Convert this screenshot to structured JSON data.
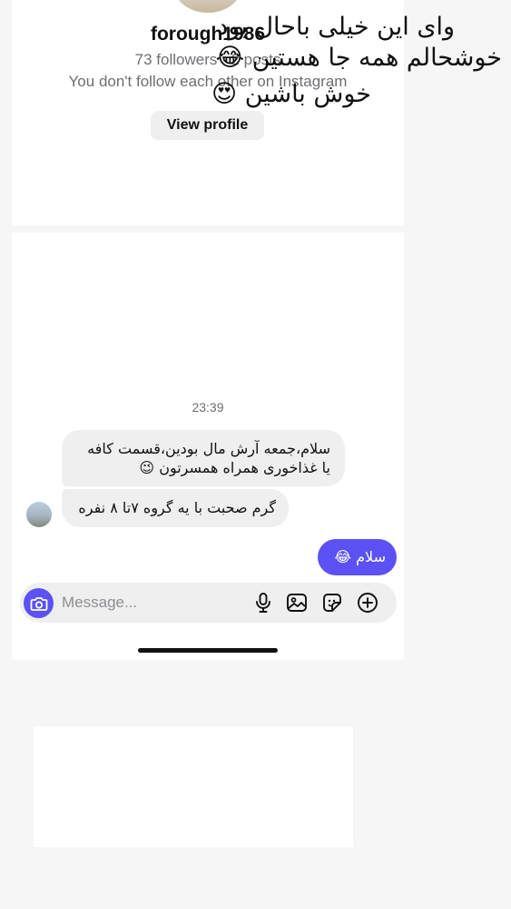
{
  "profile": {
    "username": "forough1986",
    "followers_line": "73 followers · 2 posts",
    "follow_note": "You don't follow each other on Instagram",
    "view_profile_label": "View profile"
  },
  "conversation": {
    "timestamp": "23:39",
    "messages": [
      {
        "direction": "incoming",
        "text": "سلام،جمعه آرش مال بودین،قسمت کافه یا غذاخوری همراه همسرتون 😉"
      },
      {
        "direction": "incoming",
        "text": "گرم صحبت با یه گروه ۷تا ۸ نفره"
      },
      {
        "direction": "outgoing",
        "text": "سلام 😂"
      }
    ]
  },
  "composer": {
    "placeholder": "Message...",
    "icons": [
      "camera-icon",
      "microphone-icon",
      "gallery-icon",
      "sticker-icon",
      "add-icon"
    ]
  },
  "caption": {
    "lines": [
      "وای این خیلی باحال بود",
      "خوشحالم همه جا هستین 😂",
      "خوش باشین 😍"
    ]
  },
  "colors": {
    "accent": "#5b51f5",
    "bubble_incoming": "#efefef",
    "secondary_text": "#6e6e73"
  }
}
